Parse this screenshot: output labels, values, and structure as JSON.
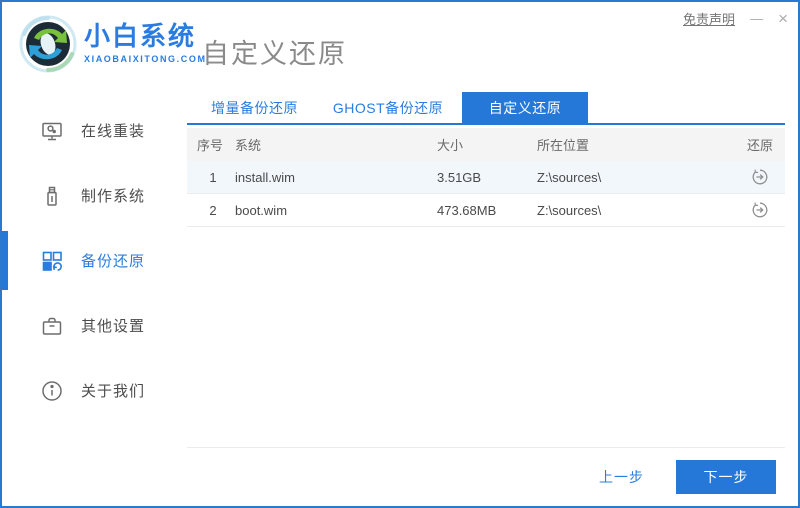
{
  "window": {
    "disclaimer_label": "免责声明",
    "minimize_glyph": "—",
    "close_glyph": "×"
  },
  "brand": {
    "name": "小白系统",
    "domain": "XIAOBAIXITONG.COM"
  },
  "page": {
    "title": "自定义还原"
  },
  "sidebar": {
    "items": [
      {
        "label": "在线重装",
        "icon": "monitor-icon",
        "active": false
      },
      {
        "label": "制作系统",
        "icon": "usb-drive-icon",
        "active": false
      },
      {
        "label": "备份还原",
        "icon": "backup-grid-icon",
        "active": true
      },
      {
        "label": "其他设置",
        "icon": "briefcase-icon",
        "active": false
      },
      {
        "label": "关于我们",
        "icon": "info-icon",
        "active": false
      }
    ]
  },
  "tabs": [
    {
      "label": "增量备份还原",
      "active": false
    },
    {
      "label": "GHOST备份还原",
      "active": false
    },
    {
      "label": "自定义还原",
      "active": true
    }
  ],
  "table": {
    "headers": [
      "序号",
      "系统",
      "大小",
      "所在位置",
      "还原"
    ],
    "rows": [
      {
        "index": "1",
        "system": "install.wim",
        "size": "3.51GB",
        "location": "Z:\\sources\\",
        "action_icon": "restore-icon"
      },
      {
        "index": "2",
        "system": "boot.wim",
        "size": "473.68MB",
        "location": "Z:\\sources\\",
        "action_icon": "restore-icon"
      }
    ]
  },
  "footer": {
    "prev_label": "上一步",
    "next_label": "下一步"
  },
  "colors": {
    "accent": "#2577d8",
    "link_blue": "#2a7ce0",
    "window_border": "#2a79cf",
    "table_header_bg": "#f4f4f4",
    "row_alt_bg": "#f2f7fb",
    "title_gray": "#8a8a8a"
  }
}
